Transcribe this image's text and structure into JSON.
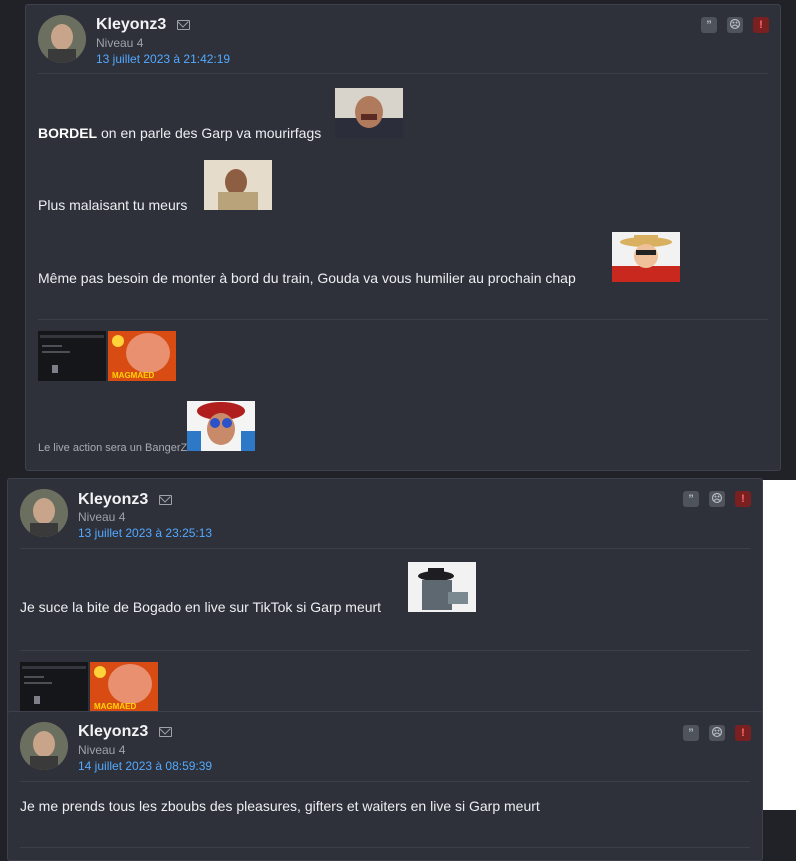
{
  "posts": [
    {
      "username": "Kleyonz3",
      "level": "Niveau 4",
      "date": "13 juillet 2023 à 21:42:19",
      "lines": [
        {
          "bold": "BORDEL",
          "text": " on en parle des Garp va mourirfags"
        },
        {
          "bold": "",
          "text": "Plus malaisant tu meurs"
        },
        {
          "bold": "",
          "text": "Même pas besoin de monter à bord du train, Gouda va vous humilier au prochain chap"
        }
      ],
      "signature_caption": "Le live action sera un BangerZ",
      "signature_banner_text": "MAGMAED"
    },
    {
      "username": "Kleyonz3",
      "level": "Niveau 4",
      "date": "13 juillet 2023 à 23:25:13",
      "lines": [
        {
          "bold": "",
          "text": "Je suce la bite de Bogado en live sur TikTok si Garp meurt"
        }
      ],
      "signature_banner_text": "MAGMAED"
    },
    {
      "username": "Kleyonz3",
      "level": "Niveau 4",
      "date": "14 juillet 2023 à 08:59:39",
      "lines": [
        {
          "bold": "",
          "text": "Je me prends tous les zboubs des pleasures, gifters et waiters en live si Garp meurt"
        }
      ]
    }
  ],
  "actions": {
    "quote": "”",
    "sad": "☹",
    "alert": "!"
  },
  "colors": {
    "date": "#53a9ff",
    "card": "#2e313a",
    "background": "#202227",
    "alert": "#7a2020"
  }
}
